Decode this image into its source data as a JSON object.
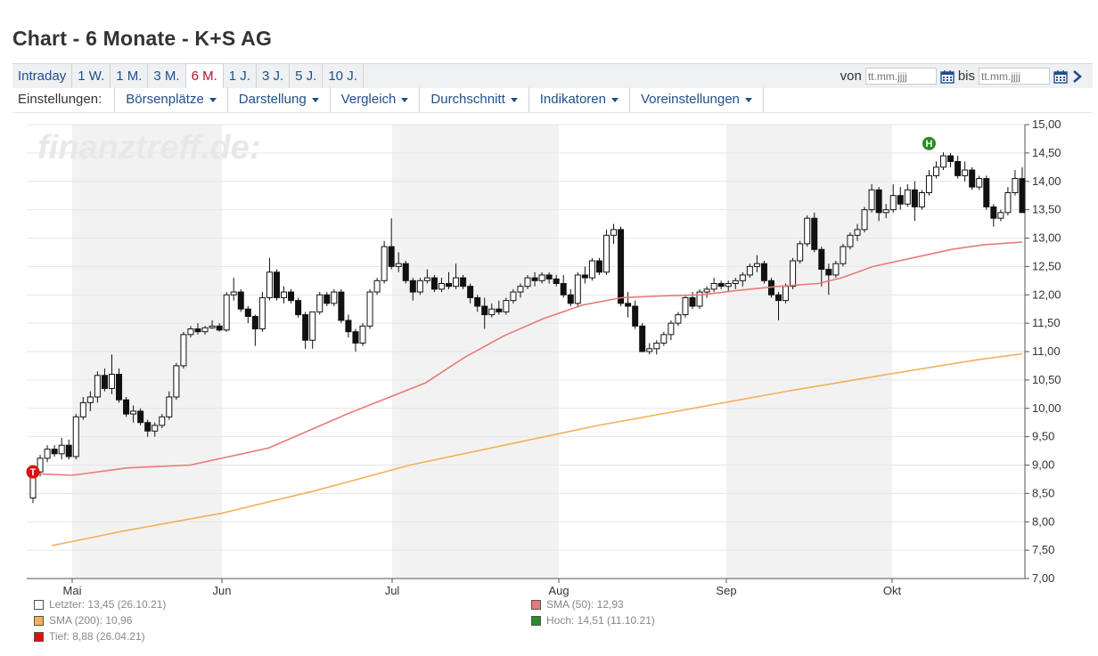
{
  "page": {
    "title": "Chart - 6 Monate - K+S AG"
  },
  "range_tabs": [
    {
      "label": "Intraday"
    },
    {
      "label": "1 W."
    },
    {
      "label": "1 M."
    },
    {
      "label": "3 M."
    },
    {
      "label": "6 M.",
      "active": true
    },
    {
      "label": "1 J."
    },
    {
      "label": "3 J."
    },
    {
      "label": "5 J."
    },
    {
      "label": "10 J."
    }
  ],
  "date_range": {
    "from_label": "von",
    "from_placeholder": "tt.mm.jjjj",
    "to_label": "bis",
    "to_placeholder": "tt.mm.jjjj"
  },
  "settings": {
    "label": "Einstellungen:",
    "menus": [
      {
        "label": "Börsenplätze"
      },
      {
        "label": "Darstellung"
      },
      {
        "label": "Vergleich"
      },
      {
        "label": "Durchschnitt"
      },
      {
        "label": "Indikatoren"
      },
      {
        "label": "Voreinstellungen"
      }
    ]
  },
  "colors": {
    "link": "#1f4f8a",
    "active": "#b0102a",
    "sma50": "#e87a78",
    "sma200": "#f3b05a",
    "high": "#2a8a2a",
    "low": "#dd1111"
  },
  "chart_data": {
    "type": "candlestick",
    "watermark": "finanztreff.de:",
    "y_ticks": [
      "15,00",
      "14,50",
      "14,00",
      "13,50",
      "13,00",
      "12,50",
      "12,00",
      "11,50",
      "11,00",
      "10,50",
      "10,00",
      "9,50",
      "9,00",
      "8,50",
      "8,00",
      "7,50",
      "7,00"
    ],
    "ylim": [
      7,
      15
    ],
    "x_months": [
      "Mai",
      "Jun",
      "Jul",
      "Aug",
      "Sep",
      "Okt"
    ],
    "grid": true,
    "candles": [
      [
        8.42,
        8.9,
        8.33,
        8.88
      ],
      [
        8.88,
        9.18,
        8.8,
        9.12
      ],
      [
        9.12,
        9.35,
        9.05,
        9.28
      ],
      [
        9.28,
        9.35,
        9.15,
        9.2
      ],
      [
        9.2,
        9.48,
        9.1,
        9.35
      ],
      [
        9.35,
        9.45,
        9.1,
        9.15
      ],
      [
        9.15,
        9.9,
        9.1,
        9.85
      ],
      [
        9.85,
        10.2,
        9.8,
        10.1
      ],
      [
        10.1,
        10.3,
        9.95,
        10.2
      ],
      [
        10.2,
        10.65,
        10.1,
        10.58
      ],
      [
        10.58,
        10.7,
        10.3,
        10.35
      ],
      [
        10.35,
        10.95,
        10.25,
        10.6
      ],
      [
        10.6,
        10.7,
        10.1,
        10.15
      ],
      [
        10.15,
        10.2,
        9.85,
        9.9
      ],
      [
        9.9,
        10.05,
        9.75,
        9.95
      ],
      [
        9.95,
        10.0,
        9.7,
        9.75
      ],
      [
        9.75,
        9.8,
        9.5,
        9.6
      ],
      [
        9.6,
        9.75,
        9.5,
        9.7
      ],
      [
        9.7,
        9.9,
        9.65,
        9.85
      ],
      [
        9.85,
        10.3,
        9.8,
        10.2
      ],
      [
        10.2,
        10.8,
        10.15,
        10.75
      ],
      [
        10.75,
        11.35,
        10.7,
        11.3
      ],
      [
        11.3,
        11.45,
        11.25,
        11.4
      ],
      [
        11.4,
        11.5,
        11.3,
        11.35
      ],
      [
        11.35,
        11.45,
        11.3,
        11.42
      ],
      [
        11.42,
        11.55,
        11.4,
        11.45
      ],
      [
        11.45,
        11.5,
        11.35,
        11.38
      ],
      [
        11.38,
        12.05,
        11.35,
        12.0
      ],
      [
        12.0,
        12.3,
        11.9,
        12.05
      ],
      [
        12.05,
        12.1,
        11.7,
        11.75
      ],
      [
        11.75,
        11.8,
        11.5,
        11.62
      ],
      [
        11.62,
        11.65,
        11.1,
        11.4
      ],
      [
        11.4,
        12.05,
        11.35,
        11.95
      ],
      [
        11.95,
        12.65,
        11.9,
        12.4
      ],
      [
        12.4,
        12.45,
        11.9,
        11.95
      ],
      [
        11.95,
        12.15,
        11.85,
        12.05
      ],
      [
        12.05,
        12.1,
        11.85,
        11.9
      ],
      [
        11.9,
        11.95,
        11.6,
        11.65
      ],
      [
        11.65,
        11.7,
        11.05,
        11.2
      ],
      [
        11.2,
        11.7,
        11.05,
        11.7
      ],
      [
        11.7,
        12.05,
        11.65,
        12.0
      ],
      [
        12.0,
        12.05,
        11.8,
        11.85
      ],
      [
        11.85,
        12.1,
        11.8,
        12.05
      ],
      [
        12.05,
        12.1,
        11.5,
        11.55
      ],
      [
        11.55,
        11.65,
        11.25,
        11.35
      ],
      [
        11.35,
        11.4,
        11.0,
        11.15
      ],
      [
        11.15,
        11.5,
        11.1,
        11.45
      ],
      [
        11.45,
        12.1,
        11.4,
        12.05
      ],
      [
        12.05,
        12.3,
        12.0,
        12.25
      ],
      [
        12.25,
        12.95,
        12.2,
        12.85
      ],
      [
        12.85,
        13.35,
        12.45,
        12.5
      ],
      [
        12.5,
        12.75,
        12.4,
        12.55
      ],
      [
        12.55,
        12.6,
        12.2,
        12.25
      ],
      [
        12.25,
        12.3,
        11.9,
        12.05
      ],
      [
        12.05,
        12.3,
        12.0,
        12.25
      ],
      [
        12.25,
        12.45,
        12.2,
        12.3
      ],
      [
        12.3,
        12.35,
        12.05,
        12.1
      ],
      [
        12.1,
        12.3,
        12.05,
        12.2
      ],
      [
        12.2,
        12.4,
        12.1,
        12.15
      ],
      [
        12.15,
        12.55,
        12.1,
        12.3
      ],
      [
        12.3,
        12.35,
        12.1,
        12.15
      ],
      [
        12.15,
        12.2,
        11.85,
        11.95
      ],
      [
        11.95,
        12.0,
        11.7,
        11.8
      ],
      [
        11.8,
        11.95,
        11.4,
        11.65
      ],
      [
        11.65,
        11.85,
        11.6,
        11.75
      ],
      [
        11.75,
        11.9,
        11.65,
        11.7
      ],
      [
        11.7,
        11.95,
        11.65,
        11.9
      ],
      [
        11.9,
        12.1,
        11.85,
        12.05
      ],
      [
        12.05,
        12.2,
        11.95,
        12.15
      ],
      [
        12.15,
        12.35,
        12.1,
        12.3
      ],
      [
        12.3,
        12.4,
        12.15,
        12.25
      ],
      [
        12.25,
        12.4,
        12.2,
        12.35
      ],
      [
        12.35,
        12.4,
        12.2,
        12.28
      ],
      [
        12.28,
        12.35,
        12.15,
        12.2
      ],
      [
        12.2,
        12.35,
        11.95,
        12.0
      ],
      [
        12.0,
        12.1,
        11.8,
        11.85
      ],
      [
        11.85,
        12.4,
        11.8,
        12.35
      ],
      [
        12.35,
        12.5,
        12.2,
        12.3
      ],
      [
        12.3,
        12.65,
        12.25,
        12.6
      ],
      [
        12.6,
        12.65,
        12.35,
        12.4
      ],
      [
        12.4,
        13.15,
        12.35,
        13.05
      ],
      [
        13.05,
        13.25,
        12.9,
        13.15
      ],
      [
        13.15,
        13.2,
        11.8,
        11.85
      ],
      [
        11.85,
        12.05,
        11.6,
        11.8
      ],
      [
        11.8,
        11.9,
        11.4,
        11.45
      ],
      [
        11.45,
        11.5,
        11.0,
        11.0
      ],
      [
        11.0,
        11.15,
        10.95,
        11.05
      ],
      [
        11.05,
        11.2,
        10.95,
        11.15
      ],
      [
        11.15,
        11.35,
        11.1,
        11.3
      ],
      [
        11.3,
        11.55,
        11.2,
        11.5
      ],
      [
        11.5,
        11.7,
        11.45,
        11.65
      ],
      [
        11.65,
        12.0,
        11.6,
        11.95
      ],
      [
        11.95,
        12.05,
        11.75,
        11.8
      ],
      [
        11.8,
        12.1,
        11.75,
        12.05
      ],
      [
        12.05,
        12.15,
        11.95,
        12.1
      ],
      [
        12.1,
        12.3,
        12.05,
        12.2
      ],
      [
        12.2,
        12.25,
        12.1,
        12.15
      ],
      [
        12.15,
        12.25,
        12.05,
        12.2
      ],
      [
        12.2,
        12.3,
        12.1,
        12.25
      ],
      [
        12.25,
        12.4,
        12.15,
        12.35
      ],
      [
        12.35,
        12.55,
        12.3,
        12.5
      ],
      [
        12.5,
        12.7,
        12.4,
        12.55
      ],
      [
        12.55,
        12.6,
        12.2,
        12.25
      ],
      [
        12.25,
        12.3,
        11.95,
        12.0
      ],
      [
        12.0,
        12.05,
        11.55,
        11.9
      ],
      [
        11.9,
        12.2,
        11.85,
        12.15
      ],
      [
        12.15,
        12.65,
        12.1,
        12.6
      ],
      [
        12.6,
        12.95,
        12.55,
        12.9
      ],
      [
        12.9,
        13.4,
        12.85,
        13.35
      ],
      [
        13.35,
        13.45,
        12.75,
        12.8
      ],
      [
        12.8,
        12.85,
        12.15,
        12.45
      ],
      [
        12.45,
        12.55,
        12.0,
        12.35
      ],
      [
        12.35,
        12.6,
        12.3,
        12.55
      ],
      [
        12.55,
        12.9,
        12.5,
        12.85
      ],
      [
        12.85,
        13.1,
        12.8,
        13.05
      ],
      [
        13.05,
        13.25,
        12.95,
        13.15
      ],
      [
        13.15,
        13.55,
        13.1,
        13.5
      ],
      [
        13.5,
        13.95,
        13.45,
        13.85
      ],
      [
        13.85,
        13.9,
        13.3,
        13.45
      ],
      [
        13.45,
        13.6,
        13.35,
        13.5
      ],
      [
        13.5,
        13.95,
        13.45,
        13.75
      ],
      [
        13.75,
        13.9,
        13.5,
        13.6
      ],
      [
        13.6,
        13.95,
        13.55,
        13.85
      ],
      [
        13.85,
        14.0,
        13.3,
        13.55
      ],
      [
        13.55,
        13.85,
        13.5,
        13.8
      ],
      [
        13.8,
        14.2,
        13.75,
        14.1
      ],
      [
        14.1,
        14.35,
        14.05,
        14.25
      ],
      [
        14.25,
        14.51,
        14.2,
        14.45
      ],
      [
        14.45,
        14.5,
        14.25,
        14.35
      ],
      [
        14.35,
        14.45,
        14.05,
        14.1
      ],
      [
        14.1,
        14.35,
        14.0,
        14.2
      ],
      [
        14.2,
        14.25,
        13.85,
        13.9
      ],
      [
        13.9,
        14.1,
        13.85,
        14.05
      ],
      [
        14.05,
        14.1,
        13.5,
        13.55
      ],
      [
        13.55,
        13.6,
        13.2,
        13.35
      ],
      [
        13.35,
        13.5,
        13.3,
        13.45
      ],
      [
        13.45,
        13.9,
        13.4,
        13.8
      ],
      [
        13.8,
        14.2,
        13.75,
        14.05
      ],
      [
        14.05,
        14.25,
        13.5,
        13.45
      ]
    ],
    "sma50": [
      [
        0,
        8.85
      ],
      [
        0.05,
        8.82
      ],
      [
        0.12,
        8.95
      ],
      [
        0.2,
        9.0
      ],
      [
        0.3,
        9.3
      ],
      [
        0.4,
        9.9
      ],
      [
        0.5,
        10.45
      ],
      [
        0.55,
        10.9
      ],
      [
        0.6,
        11.28
      ],
      [
        0.65,
        11.58
      ],
      [
        0.7,
        11.82
      ],
      [
        0.75,
        11.95
      ],
      [
        0.8,
        11.98
      ],
      [
        0.85,
        12.0
      ],
      [
        0.9,
        12.08
      ],
      [
        0.95,
        12.15
      ],
      [
        1.0,
        12.2
      ],
      [
        1.03,
        12.3
      ],
      [
        1.07,
        12.5
      ],
      [
        1.12,
        12.65
      ],
      [
        1.17,
        12.8
      ],
      [
        1.21,
        12.88
      ],
      [
        1.26,
        12.93
      ]
    ],
    "sma200": [
      [
        0.04,
        7.58
      ],
      [
        0.2,
        7.85
      ],
      [
        0.4,
        8.15
      ],
      [
        0.6,
        8.55
      ],
      [
        0.8,
        9.0
      ],
      [
        1.0,
        9.35
      ],
      [
        1.2,
        9.7
      ],
      [
        1.4,
        10.0
      ],
      [
        1.6,
        10.3
      ],
      [
        1.8,
        10.58
      ],
      [
        2.0,
        10.85
      ],
      [
        2.1,
        10.96
      ]
    ],
    "markers": {
      "high": {
        "label": "H",
        "index": 125,
        "value": 14.51
      },
      "low": {
        "label": "T",
        "index": 0,
        "value": 8.88
      }
    },
    "legend": [
      {
        "name": "Letzter: 13,45 (26.10.21)",
        "swatch": "#ffffff"
      },
      {
        "name": "SMA (50): 12,93",
        "swatch": "#e87a78"
      },
      {
        "name": "SMA (200): 10,96",
        "swatch": "#f3b05a"
      },
      {
        "name": "Hoch: 14,51 (11.10.21)",
        "swatch": "#2a8a2a"
      },
      {
        "name": "Tief: 8,88 (26.04.21)",
        "swatch": "#dd1111"
      }
    ]
  }
}
